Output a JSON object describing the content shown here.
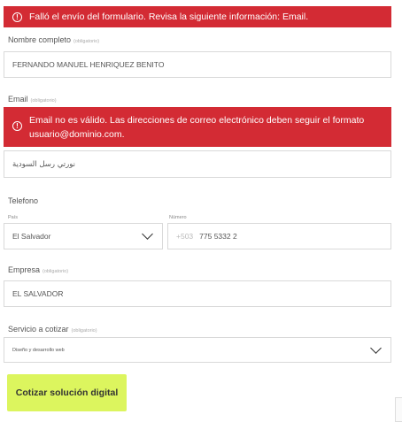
{
  "form": {
    "error_banner": "Falló el envío del formulario. Revisa la siguiente información: Email.",
    "required_tag": "(obligatorio)",
    "name": {
      "label": "Nombre completo",
      "value": "FERNANDO MANUEL HENRIQUEZ BENITO"
    },
    "email": {
      "label": "Email",
      "error_line1": "Email no es válido. Las direcciones de correo electrónico deben seguir el formato",
      "error_line2": "usuario@dominio.com.",
      "value": "نورتي رسل السودية"
    },
    "phone": {
      "label": "Telefono",
      "country_label": "País",
      "country_value": "El Salvador",
      "number_label": "Número",
      "prefix": "+503",
      "number_value": "775 5332 2"
    },
    "company": {
      "label": "Empresa",
      "value": "EL SALVADOR"
    },
    "service": {
      "label": "Servicio a cotizar",
      "value": "Diseño y desarrollo web"
    },
    "submit_label": "Cotizar solución digital"
  }
}
